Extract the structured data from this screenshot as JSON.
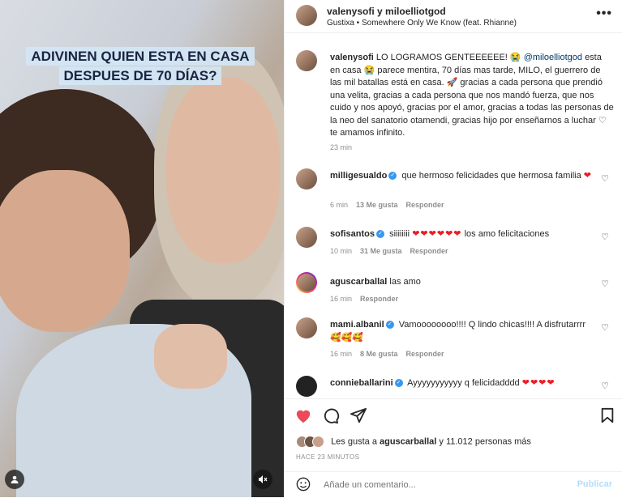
{
  "media": {
    "caption_line1": "ADIVINEN QUIEN ESTA EN CASA",
    "caption_line2": "DESPUES DE 70 DÍAS?"
  },
  "header": {
    "title": "valenysofi y miloelliotgod",
    "audio": "Gustixa • Somewhere Only We Know (feat. Rhianne)",
    "more_icon": "•••"
  },
  "post": {
    "username": "valenysofi",
    "text_a": "LO LOGRAMOS GENTEEEEEE! 😭",
    "mention": "@miloelliotgod",
    "text_b": "esta en casa 😭 parece mentira, 70 días mas tarde, MILO, el guerrero de las mil batallas está en casa. 🚀 gracias a cada persona que prendió una velita, gracias a cada persona que nos mandó fuerza, que nos cuido y nos apoyó, gracias por el amor, gracias a todas las personas de la neo del sanatorio otamendi, gracias hijo por enseñarnos a luchar ♡ te amamos infinito.",
    "time": "23 min"
  },
  "comments": [
    {
      "user": "milligesualdo",
      "verified": true,
      "text": "que hermoso felicidades que hermosa familia",
      "hearts": "❤",
      "time": "6 min",
      "likes": "13 Me gusta",
      "reply": "Responder"
    },
    {
      "user": "sofisantos",
      "verified": true,
      "text": "siiiiiiii",
      "hearts": "❤❤❤❤❤❤",
      "text2": "los amo felicitaciones",
      "time": "10 min",
      "likes": "31 Me gusta",
      "reply": "Responder"
    },
    {
      "user": "aguscarballal",
      "verified": false,
      "text": "las amo",
      "time": "16 min",
      "reply": "Responder"
    },
    {
      "user": "mami.albanil",
      "verified": true,
      "text": "Vamoooooooo!!!! Q lindo chicas!!!! A disfrutarrrr🥰🥰🥰",
      "time": "16 min",
      "likes": "8 Me gusta",
      "reply": "Responder"
    },
    {
      "user": "connieballarini",
      "verified": true,
      "text": "Ayyyyyyyyyyy q felicidadddd",
      "hearts": "❤❤❤❤"
    }
  ],
  "likes": {
    "prefix": "Les gusta a",
    "user": "aguscarballal",
    "rest": "y 11.012 personas más"
  },
  "timestamp": "HACE 23 MINUTOS",
  "composer": {
    "placeholder": "Añade un comentario...",
    "publish": "Publicar"
  },
  "icons": {
    "like": "heart-icon",
    "comment": "comment-icon",
    "share": "share-icon",
    "save": "bookmark-icon",
    "emoji": "emoji-icon",
    "user": "user-tag-icon",
    "mute": "mute-icon"
  },
  "colors": {
    "like_red": "#ed4956",
    "link_blue": "#00376b",
    "verified_blue": "#3897f0",
    "muted_gray": "#8e8e8e",
    "publish_blue": "#b2dffc"
  }
}
